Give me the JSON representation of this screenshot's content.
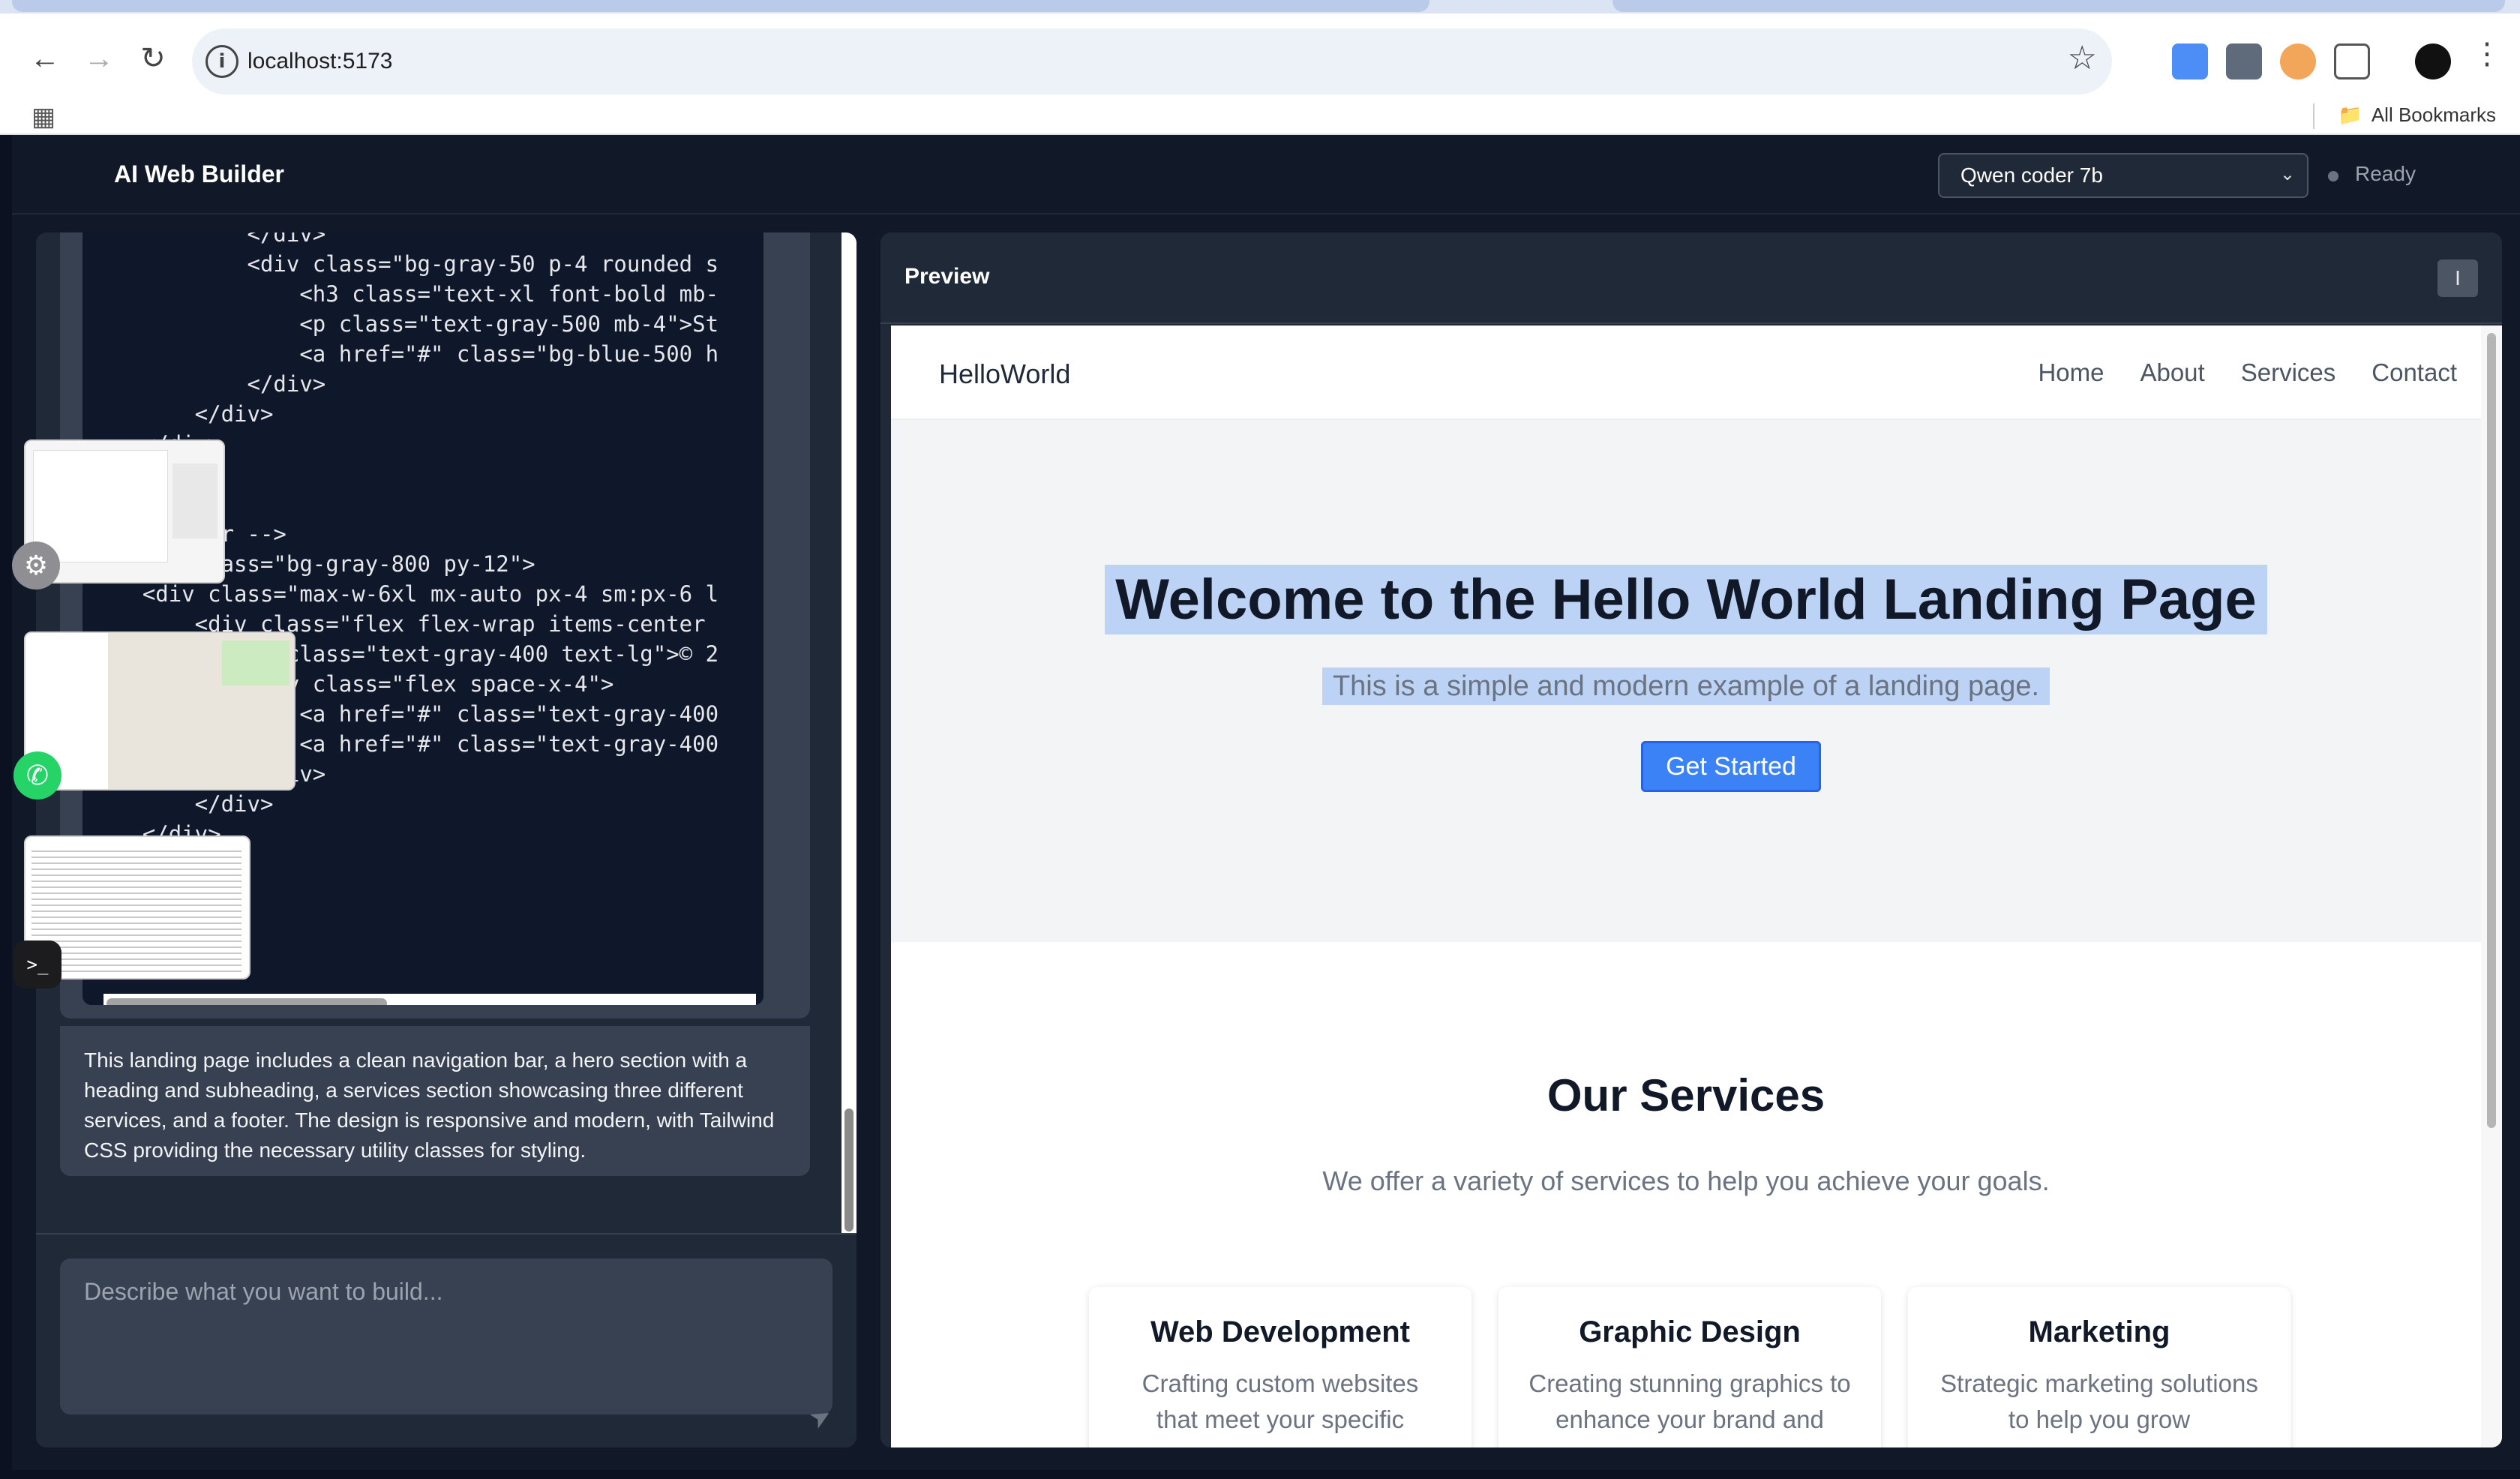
{
  "browser": {
    "url": "localhost:5173",
    "bookmarks_label": "All Bookmarks"
  },
  "app": {
    "title": "AI Web Builder",
    "model_selected": "Qwen coder 7b",
    "status": "Ready"
  },
  "chat": {
    "code_lines": [
      "            </div>",
      "            <div class=\"bg-gray-50 p-4 rounded s",
      "                <h3 class=\"text-xl font-bold mb-",
      "                <p class=\"text-gray-500 mb-4\">St",
      "                <a href=\"#\" class=\"bg-blue-500 h",
      "            </div>",
      "        </div>",
      "    </div>",
      "</section>",
      "",
      "<!-- Footer -->",
      "<footer class=\"bg-gray-800 py-12\">",
      "    <div class=\"max-w-6xl mx-auto px-4 sm:px-6 l",
      "        <div class=\"flex flex-wrap items-center",
      "            <p class=\"text-gray-400 text-lg\">© 2",
      "            <div class=\"flex space-x-4\">",
      "                <a href=\"#\" class=\"text-gray-400",
      "                <a href=\"#\" class=\"text-gray-400",
      "            </div>",
      "        </div>",
      "    </div>",
      "</footer>"
    ],
    "summary": "This landing page includes a clean navigation bar, a hero section with a heading and subheading, a services section showcasing three different services, and a footer. The design is responsive and modern, with Tailwind CSS providing the necessary utility classes for styling.",
    "input_placeholder": "Describe what you want to build..."
  },
  "preview": {
    "title": "Preview",
    "site": {
      "brand": "HelloWorld",
      "nav": [
        "Home",
        "About",
        "Services",
        "Contact"
      ],
      "hero_title": "Welcome to the Hello World Landing Page",
      "hero_subtitle": "This is a simple and modern example of a landing page.",
      "cta": "Get Started",
      "services_title": "Our Services",
      "services_subtitle": "We offer a variety of services to help you achieve your goals.",
      "cards": [
        {
          "title": "Web Development",
          "text": "Crafting custom websites that meet your specific"
        },
        {
          "title": "Graphic Design",
          "text": "Creating stunning graphics to enhance your brand and"
        },
        {
          "title": "Marketing",
          "text": "Strategic marketing solutions to help you grow"
        }
      ]
    }
  },
  "colors": {
    "app_bg": "#111827",
    "panel_bg": "#1f2937",
    "accent": "#3b82f6",
    "selection": "#bcd3f5"
  }
}
